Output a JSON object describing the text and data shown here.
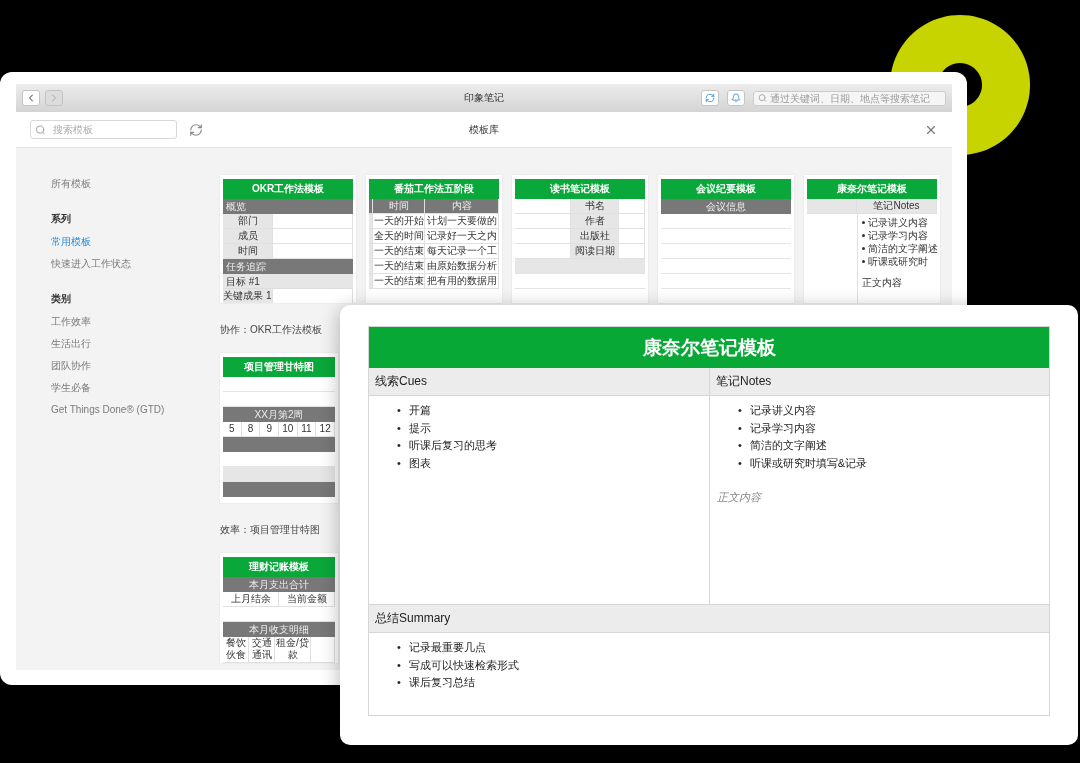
{
  "window": {
    "title": "印象笔记",
    "nav": [
      {
        "kind": "back",
        "disabled": false
      },
      {
        "kind": "forward",
        "disabled": true
      }
    ],
    "search": {
      "placeholder": "通过关键词、日期、地点等搜索笔记"
    }
  },
  "toolbar": {
    "search": {
      "placeholder": "搜索模板"
    },
    "title": "模板库"
  },
  "sidebar": [
    {
      "kind": "item",
      "label": "所有模板",
      "selected": false
    },
    {
      "kind": "heading",
      "label": "系列"
    },
    {
      "kind": "item",
      "label": "常用模板",
      "selected": true
    },
    {
      "kind": "item",
      "label": "快速进入工作状态",
      "selected": false
    },
    {
      "kind": "heading",
      "label": "类别"
    },
    {
      "kind": "item",
      "label": "工作效率",
      "selected": false
    },
    {
      "kind": "item",
      "label": "生活出行",
      "selected": false
    },
    {
      "kind": "item",
      "label": "团队协作",
      "selected": false
    },
    {
      "kind": "item",
      "label": "学生必备",
      "selected": false
    },
    {
      "kind": "item",
      "label": "Get Things Done® (GTD)",
      "selected": false
    }
  ],
  "template_rows": [
    [
      {
        "kind": "okr",
        "title": "OKR工作法模板",
        "caption": "协作：OKR工作法模板",
        "rows": [
          {
            "kind": "section",
            "text": "概览"
          },
          {
            "kind": "cells",
            "cells": [
              "部门",
              ""
            ]
          },
          {
            "kind": "cells",
            "cells": [
              "成员",
              ""
            ]
          },
          {
            "kind": "cells",
            "cells": [
              "时间",
              ""
            ]
          },
          {
            "kind": "section",
            "text": "任务追踪"
          },
          {
            "kind": "light",
            "text": "目标 #1"
          },
          {
            "kind": "cells",
            "cells": [
              "关键成果 1",
              ""
            ]
          }
        ]
      },
      {
        "kind": "tomato",
        "title": "番茄工作法五阶段",
        "rows": [
          {
            "kind": "head",
            "cells": [
              "",
              "时间",
              "内容"
            ]
          },
          {
            "kind": "cells",
            "cells": [
              "",
              "一天的开始",
              "计划一天要做的"
            ]
          },
          {
            "kind": "cells",
            "cells": [
              "",
              "全天的时间",
              "记录好一天之内"
            ]
          },
          {
            "kind": "cells",
            "cells": [
              "",
              "一天的结束",
              "每天记录一个工"
            ]
          },
          {
            "kind": "cells",
            "cells": [
              "",
              "一天的结束",
              "由原始数据分析"
            ]
          },
          {
            "kind": "cells",
            "cells": [
              "",
              "一天的结束",
              "把有用的数据用"
            ]
          }
        ]
      },
      {
        "kind": "reading",
        "title": "读书笔记模板",
        "rows": [
          {
            "kind": "cells",
            "cells": [
              "",
              "书名",
              ""
            ]
          },
          {
            "kind": "cells",
            "cells": [
              "",
              "作者",
              ""
            ]
          },
          {
            "kind": "cells",
            "cells": [
              "",
              "出版社",
              ""
            ]
          },
          {
            "kind": "cells",
            "cells": [
              "",
              "阅读日期",
              ""
            ]
          },
          {
            "kind": "shade"
          },
          {
            "kind": "blank"
          },
          {
            "kind": "blank"
          }
        ]
      },
      {
        "kind": "meeting",
        "title": "会议纪要模板",
        "rows": [
          {
            "kind": "band",
            "text": "会议信息"
          },
          {
            "kind": "blank"
          },
          {
            "kind": "blank"
          },
          {
            "kind": "blank"
          },
          {
            "kind": "blank"
          },
          {
            "kind": "blank"
          }
        ]
      },
      {
        "kind": "cornell",
        "title": "康奈尔笔记模板",
        "rows": [
          {
            "kind": "cells",
            "cells": [
              "",
              "笔记Notes"
            ]
          },
          {
            "kind": "notes",
            "items": [
              "记录讲义内容",
              "记录学习内容",
              "简洁的文字阐述",
              "听课或研究时"
            ],
            "note": "正文内容"
          }
        ]
      }
    ],
    [
      {
        "kind": "gantt",
        "title": "项目管理甘特图",
        "caption": "效率：项目管理甘特图",
        "rows": [
          {
            "kind": "blank"
          },
          {
            "kind": "blank"
          },
          {
            "kind": "band",
            "text": "XX月第2周"
          },
          {
            "kind": "cells",
            "cells": [
              "5",
              "8",
              "9",
              "10",
              "11",
              "12"
            ]
          },
          {
            "kind": "band",
            "text": ""
          },
          {
            "kind": "blank"
          },
          {
            "kind": "shade"
          },
          {
            "kind": "band",
            "text": ""
          }
        ]
      }
    ],
    [
      {
        "kind": "finance",
        "title": "理财记账模板",
        "rows": [
          {
            "kind": "band",
            "text": "本月支出合计"
          },
          {
            "kind": "cells",
            "cells": [
              "上月结余",
              "当前金额"
            ]
          },
          {
            "kind": "blank"
          },
          {
            "kind": "band",
            "text": "本月收支明细"
          },
          {
            "kind": "cells",
            "cells": [
              "餐饮伙食",
              "交通通讯",
              "租金/贷款",
              ""
            ]
          }
        ]
      }
    ]
  ],
  "preview": {
    "title": "康奈尔笔记模板",
    "marker": "•",
    "columns": [
      {
        "heading": "线索Cues",
        "items": [
          "开篇",
          "提示",
          "听课后复习的思考",
          "图表"
        ]
      },
      {
        "heading": "笔记Notes",
        "items": [
          "记录讲义内容",
          "记录学习内容",
          "简洁的文字阐述",
          "听课或研究时填写&记录"
        ],
        "note": "正文内容"
      }
    ],
    "summary": {
      "heading": "总结Summary",
      "items": [
        "记录最重要几点",
        "写成可以快速检索形式",
        "课后复习总结"
      ]
    }
  }
}
